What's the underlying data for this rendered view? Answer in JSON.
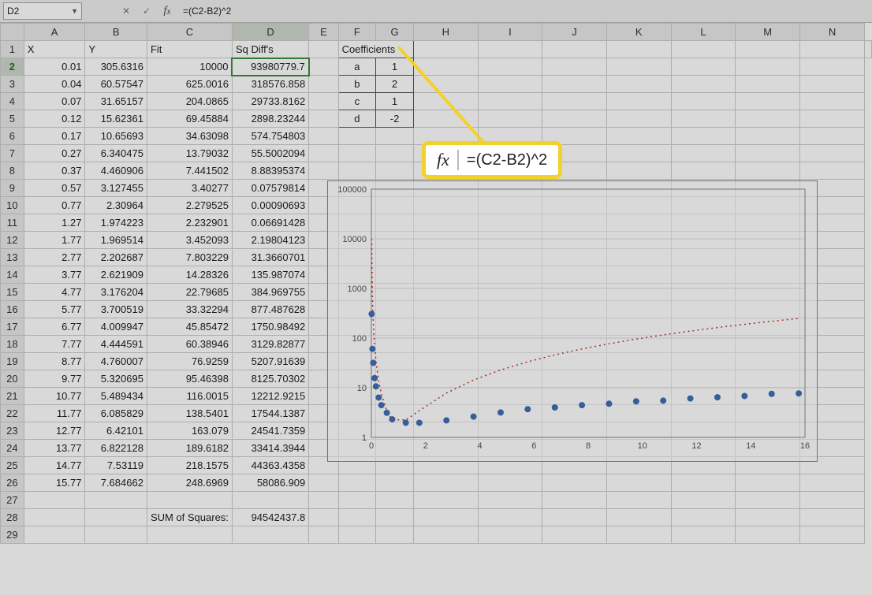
{
  "nameBox": "D2",
  "formula": "=(C2-B2)^2",
  "callout": {
    "fx": "fx",
    "formula": "=(C2-B2)^2"
  },
  "columns": [
    "A",
    "B",
    "C",
    "D",
    "E",
    "F",
    "G",
    "H",
    "I",
    "J",
    "K",
    "L",
    "M",
    "N"
  ],
  "headerRow": {
    "A": "X",
    "B": "Y",
    "C": "Fit",
    "D": "Sq Diff's",
    "F": "Coefficients"
  },
  "coefficients": [
    {
      "name": "a",
      "value": "1"
    },
    {
      "name": "b",
      "value": "2"
    },
    {
      "name": "c",
      "value": "1"
    },
    {
      "name": "d",
      "value": "-2"
    }
  ],
  "sumLabel": "SUM of Squares:",
  "sumValue": "94542437.8",
  "rows": [
    {
      "r": 2,
      "x": "0.01",
      "y": "305.6316",
      "fit": "10000",
      "sq": "93980779.7"
    },
    {
      "r": 3,
      "x": "0.04",
      "y": "60.57547",
      "fit": "625.0016",
      "sq": "318576.858"
    },
    {
      "r": 4,
      "x": "0.07",
      "y": "31.65157",
      "fit": "204.0865",
      "sq": "29733.8162"
    },
    {
      "r": 5,
      "x": "0.12",
      "y": "15.62361",
      "fit": "69.45884",
      "sq": "2898.23244"
    },
    {
      "r": 6,
      "x": "0.17",
      "y": "10.65693",
      "fit": "34.63098",
      "sq": "574.754803"
    },
    {
      "r": 7,
      "x": "0.27",
      "y": "6.340475",
      "fit": "13.79032",
      "sq": "55.5002094"
    },
    {
      "r": 8,
      "x": "0.37",
      "y": "4.460906",
      "fit": "7.441502",
      "sq": "8.88395374"
    },
    {
      "r": 9,
      "x": "0.57",
      "y": "3.127455",
      "fit": "3.40277",
      "sq": "0.07579814"
    },
    {
      "r": 10,
      "x": "0.77",
      "y": "2.30964",
      "fit": "2.279525",
      "sq": "0.00090693"
    },
    {
      "r": 11,
      "x": "1.27",
      "y": "1.974223",
      "fit": "2.232901",
      "sq": "0.06691428"
    },
    {
      "r": 12,
      "x": "1.77",
      "y": "1.969514",
      "fit": "3.452093",
      "sq": "2.19804123"
    },
    {
      "r": 13,
      "x": "2.77",
      "y": "2.202687",
      "fit": "7.803229",
      "sq": "31.3660701"
    },
    {
      "r": 14,
      "x": "3.77",
      "y": "2.621909",
      "fit": "14.28326",
      "sq": "135.987074"
    },
    {
      "r": 15,
      "x": "4.77",
      "y": "3.176204",
      "fit": "22.79685",
      "sq": "384.969755"
    },
    {
      "r": 16,
      "x": "5.77",
      "y": "3.700519",
      "fit": "33.32294",
      "sq": "877.487628"
    },
    {
      "r": 17,
      "x": "6.77",
      "y": "4.009947",
      "fit": "45.85472",
      "sq": "1750.98492"
    },
    {
      "r": 18,
      "x": "7.77",
      "y": "4.444591",
      "fit": "60.38946",
      "sq": "3129.82877"
    },
    {
      "r": 19,
      "x": "8.77",
      "y": "4.760007",
      "fit": "76.9259",
      "sq": "5207.91639"
    },
    {
      "r": 20,
      "x": "9.77",
      "y": "5.320695",
      "fit": "95.46398",
      "sq": "8125.70302"
    },
    {
      "r": 21,
      "x": "10.77",
      "y": "5.489434",
      "fit": "116.0015",
      "sq": "12212.9215"
    },
    {
      "r": 22,
      "x": "11.77",
      "y": "6.085829",
      "fit": "138.5401",
      "sq": "17544.1387"
    },
    {
      "r": 23,
      "x": "12.77",
      "y": "6.42101",
      "fit": "163.079",
      "sq": "24541.7359"
    },
    {
      "r": 24,
      "x": "13.77",
      "y": "6.822128",
      "fit": "189.6182",
      "sq": "33414.3944"
    },
    {
      "r": 25,
      "x": "14.77",
      "y": "7.53119",
      "fit": "218.1575",
      "sq": "44363.4358"
    },
    {
      "r": 26,
      "x": "15.77",
      "y": "7.684662",
      "fit": "248.6969",
      "sq": "58086.909"
    }
  ],
  "chart_data": {
    "type": "scatter",
    "title": "",
    "xlabel": "",
    "ylabel": "",
    "xlim": [
      0,
      16
    ],
    "ylim": [
      1,
      100000
    ],
    "yscale": "log",
    "xticks": [
      0,
      2,
      4,
      6,
      8,
      10,
      12,
      14,
      16
    ],
    "yticks": [
      1,
      10,
      100,
      1000,
      10000,
      100000
    ],
    "series": [
      {
        "name": "Y",
        "style": "points",
        "color": "#3f6fb5",
        "x": [
          0.01,
          0.04,
          0.07,
          0.12,
          0.17,
          0.27,
          0.37,
          0.57,
          0.77,
          1.27,
          1.77,
          2.77,
          3.77,
          4.77,
          5.77,
          6.77,
          7.77,
          8.77,
          9.77,
          10.77,
          11.77,
          12.77,
          13.77,
          14.77,
          15.77
        ],
        "y": [
          305.6316,
          60.57547,
          31.65157,
          15.62361,
          10.65693,
          6.340475,
          4.460906,
          3.127455,
          2.30964,
          1.974223,
          1.969514,
          2.202687,
          2.621909,
          3.176204,
          3.700519,
          4.009947,
          4.444591,
          4.760007,
          5.320695,
          5.489434,
          6.085829,
          6.42101,
          6.822128,
          7.53119,
          7.684662
        ]
      },
      {
        "name": "Fit",
        "style": "dotted-line",
        "color": "#c0392b",
        "x": [
          0.01,
          0.04,
          0.07,
          0.12,
          0.17,
          0.27,
          0.37,
          0.57,
          0.77,
          1.27,
          1.77,
          2.77,
          3.77,
          4.77,
          5.77,
          6.77,
          7.77,
          8.77,
          9.77,
          10.77,
          11.77,
          12.77,
          13.77,
          14.77,
          15.77
        ],
        "y": [
          10000,
          625.0016,
          204.0865,
          69.45884,
          34.63098,
          13.79032,
          7.441502,
          3.40277,
          2.279525,
          2.232901,
          3.452093,
          7.803229,
          14.28326,
          22.79685,
          33.32294,
          45.85472,
          60.38946,
          76.9259,
          95.46398,
          116.0015,
          138.5401,
          163.079,
          189.6182,
          218.1575,
          248.6969
        ]
      }
    ]
  }
}
